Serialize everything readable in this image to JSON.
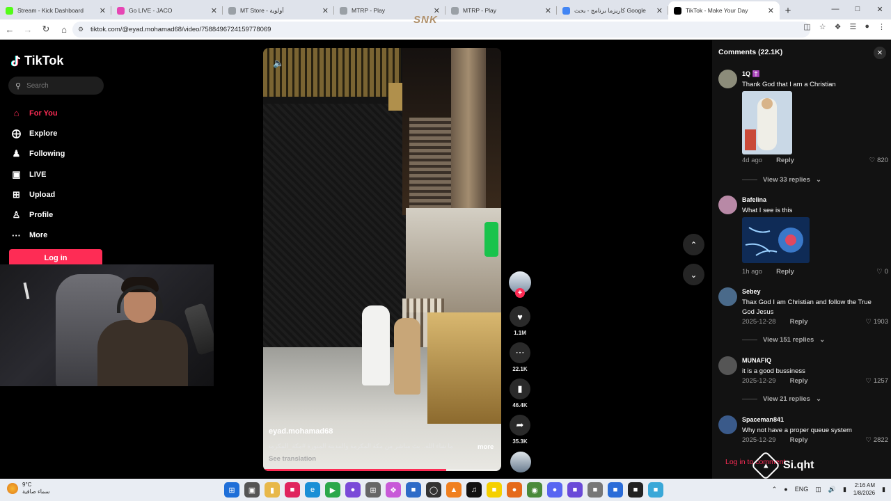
{
  "browser": {
    "tabs": [
      {
        "label": "Stream - Kick Dashboard",
        "color": "#53fc18"
      },
      {
        "label": "Go LIVE - JACO",
        "color": "#e646b4"
      },
      {
        "label": "MT Store - أولوية",
        "color": "#9aa0a6"
      },
      {
        "label": "MTRP - Play",
        "color": "#9aa0a6"
      },
      {
        "label": "MTRP - Play",
        "color": "#9aa0a6"
      },
      {
        "label": "كاريزما برنامج - بحث Google",
        "color": "#4285f4"
      },
      {
        "label": "TikTok - Make Your Day",
        "color": "#000000"
      }
    ],
    "url": "tiktok.com/@eyad.mohamad68/video/7588496724159778069",
    "watermark": "SNK"
  },
  "sidebar": {
    "logo": "TikTok",
    "search_placeholder": "Search",
    "nav": [
      {
        "label": "For You",
        "icon": "home-icon",
        "active": true
      },
      {
        "label": "Explore",
        "icon": "compass-icon",
        "active": false
      },
      {
        "label": "Following",
        "icon": "person-icon",
        "active": false
      },
      {
        "label": "LIVE",
        "icon": "live-icon",
        "active": false
      },
      {
        "label": "Upload",
        "icon": "plus-square-icon",
        "active": false
      },
      {
        "label": "Profile",
        "icon": "profile-icon",
        "active": false
      },
      {
        "label": "More",
        "icon": "more-icon",
        "active": false
      }
    ],
    "login_label": "Log in"
  },
  "video": {
    "username": "eyad.mohamad68",
    "description": "ما شاء الله.. بث مباشر من مكة المكرمة والمدينة المنورة #مكة_المكرمة",
    "more_label": "more",
    "translation_label": "See translation",
    "progress": 0.77
  },
  "actions": {
    "likes": "1.1M",
    "comments": "22.1K",
    "saves": "46.4K",
    "shares": "35.3K"
  },
  "comments_panel": {
    "title": "Comments (22.1K)",
    "items": [
      {
        "user": "1Q ✝️",
        "text": "Thank God that I am a Christian",
        "time": "4d ago",
        "reply": "Reply",
        "likes": "820",
        "replies": "View 33 replies",
        "avatar": "#8c8c7a"
      },
      {
        "user": "Bafelina",
        "text": "What I see is this",
        "time": "1h ago",
        "reply": "Reply",
        "likes": "0",
        "replies": "",
        "avatar": "#b889a6"
      },
      {
        "user": "Sebey",
        "text": "Thax God I am Christian and follow the True God Jesus",
        "time": "2025-12-28",
        "reply": "Reply",
        "likes": "1903",
        "replies": "View 151 replies",
        "avatar": "#4a6a8a"
      },
      {
        "user": "MUNAFIQ",
        "text": "it is a good bussiness",
        "time": "2025-12-29",
        "reply": "Reply",
        "likes": "1257",
        "replies": "View 21 replies",
        "avatar": "#555555"
      },
      {
        "user": "Spaceman841",
        "text": "Why not have a proper queue system",
        "time": "2025-12-29",
        "reply": "Reply",
        "likes": "2822",
        "replies": "",
        "avatar": "#3a5a8a"
      }
    ],
    "login_prompt": "Log in to comment"
  },
  "overlay": {
    "brand": "Si.qht"
  },
  "taskbar": {
    "temp": "9°C",
    "weather_desc": "سماء صافية",
    "lang": "ENG",
    "time": "2:16 AM",
    "date": "1/8/2026"
  }
}
